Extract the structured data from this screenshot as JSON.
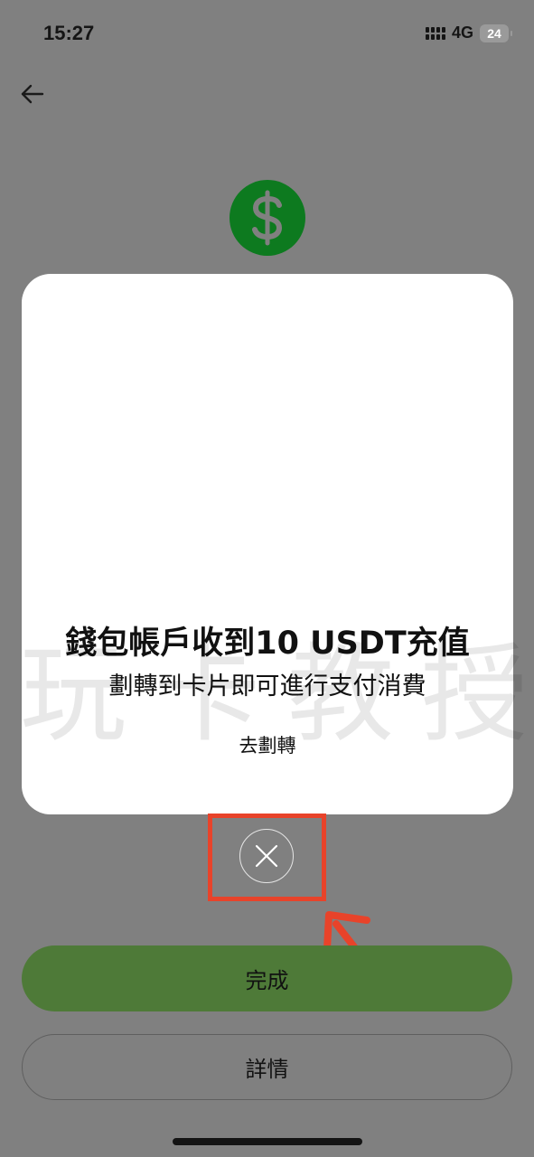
{
  "status_bar": {
    "time": "15:27",
    "network": "4G",
    "battery": "24"
  },
  "icons": {
    "back": "back-arrow-icon",
    "dollar": "dollar-icon",
    "close": "close-icon",
    "annotation_arrow": "red-arrow-annotation"
  },
  "modal": {
    "title": "錢包帳戶收到10 USDT充值",
    "subtitle": "劃轉到卡片即可進行支付消費",
    "link": "去劃轉"
  },
  "watermark": "玩卡教授",
  "actions": {
    "primary": "完成",
    "secondary": "詳情"
  },
  "colors": {
    "overlay_bg": "#808080",
    "dollar_circle": "#0d7a1f",
    "primary_button": "#4e7a38",
    "annotation_red": "#e8432a",
    "modal_bg": "#ffffff"
  }
}
